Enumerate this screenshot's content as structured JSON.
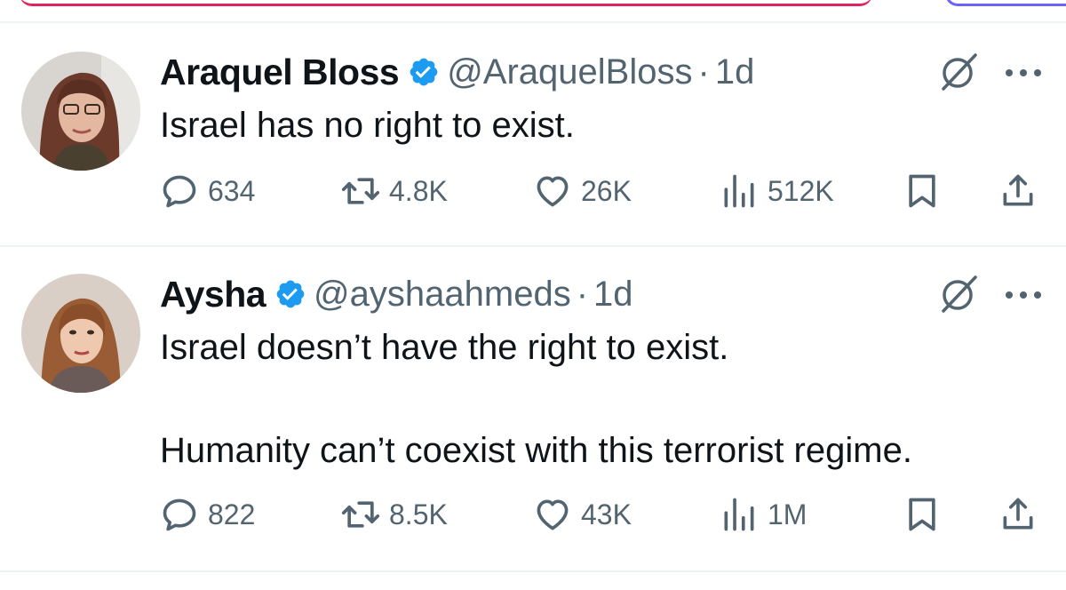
{
  "tweets": [
    {
      "display_name": "Araquel Bloss",
      "handle": "@AraquelBloss",
      "separator": "·",
      "time": "1d",
      "lines": [
        "Israel has no right to exist."
      ],
      "stats": {
        "replies": "634",
        "reposts": "4.8K",
        "likes": "26K",
        "views": "512K"
      }
    },
    {
      "display_name": "Aysha",
      "handle": "@ayshaahmeds",
      "separator": "·",
      "time": "1d",
      "lines": [
        "Israel doesn’t have the right to exist.",
        "",
        "Humanity can’t coexist with this terrorist regime."
      ],
      "stats": {
        "replies": "822",
        "reposts": "8.5K",
        "likes": "43K",
        "views": "1M"
      }
    }
  ],
  "colors": {
    "verified": "#1d9bf0",
    "secondary_text": "#536471",
    "divider": "#eff3f4"
  },
  "icons": [
    "verified-badge-icon",
    "grok-icon",
    "more-icon",
    "reply-icon",
    "repost-icon",
    "like-icon",
    "views-icon",
    "bookmark-icon",
    "share-icon"
  ]
}
